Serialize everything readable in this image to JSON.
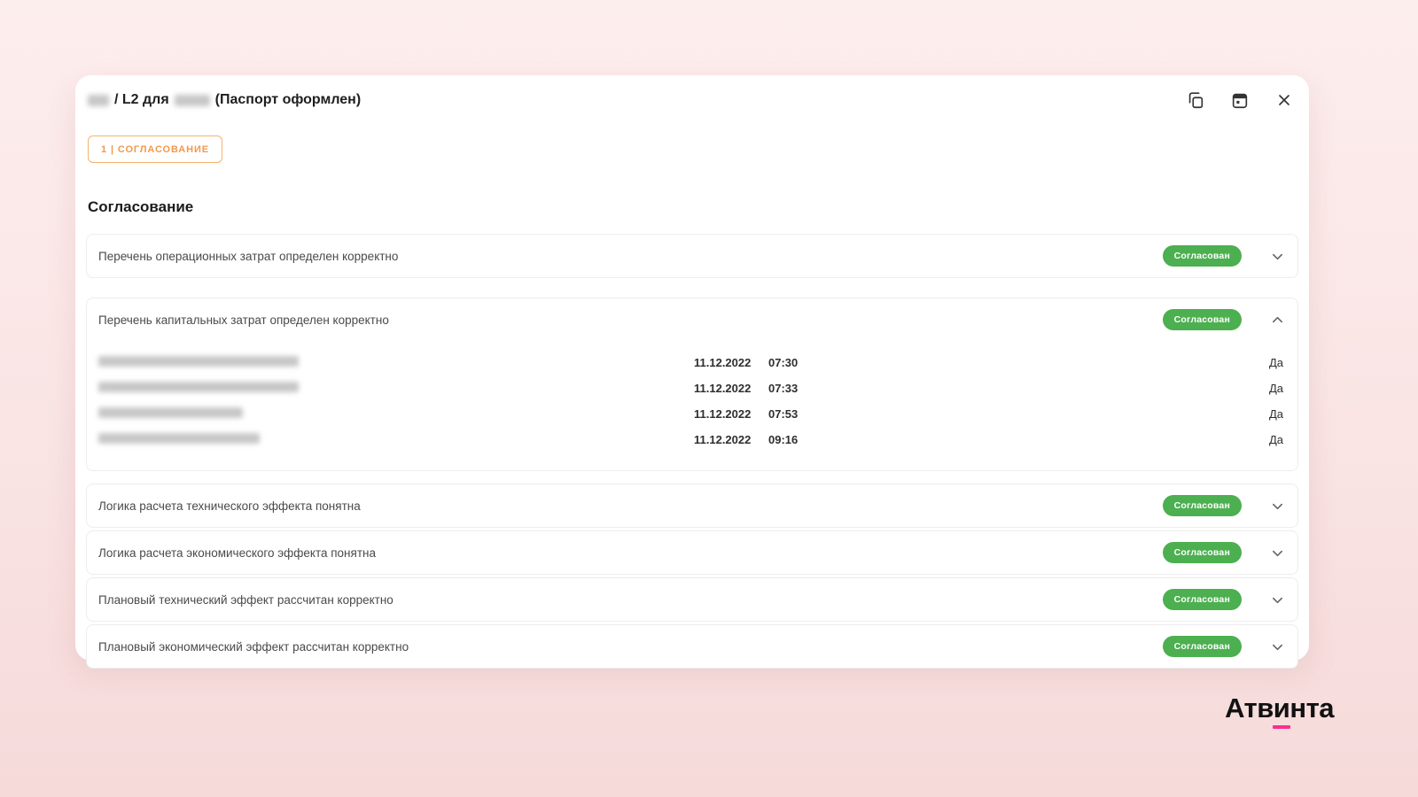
{
  "colors": {
    "status_green": "#4CAF50",
    "accent_orange": "#F2994A",
    "logo_pink": "#FF2E8D"
  },
  "header": {
    "title_part1": "/ L2 для",
    "title_part2": "(Паспорт оформлен)",
    "icons": [
      "copy-icon",
      "calendar-icon",
      "close-icon"
    ]
  },
  "stage_badge": {
    "label": "1 | СОГЛАСОВАНИЕ"
  },
  "section": {
    "title": "Согласование"
  },
  "approval": {
    "items": [
      {
        "label": "Перечень операционных затрат определен корректно",
        "status": "Согласован",
        "expanded": false
      },
      {
        "label": "Перечень капитальных затрат определен корректно",
        "status": "Согласован",
        "expanded": true,
        "approvers": [
          {
            "name": "",
            "date": "11.12.2022",
            "time": "07:30",
            "answer": "Да"
          },
          {
            "name": "",
            "date": "11.12.2022",
            "time": "07:33",
            "answer": "Да"
          },
          {
            "name": "",
            "date": "11.12.2022",
            "time": "07:53",
            "answer": "Да"
          },
          {
            "name": "",
            "date": "11.12.2022",
            "time": "09:16",
            "answer": "Да"
          }
        ]
      },
      {
        "label": "Логика расчета технического эффекта понятна",
        "status": "Согласован",
        "expanded": false
      },
      {
        "label": "Логика расчета экономического эффекта понятна",
        "status": "Согласован",
        "expanded": false
      },
      {
        "label": "Плановый технический эффект рассчитан корректно",
        "status": "Согласован",
        "expanded": false
      },
      {
        "label": "Плановый экономический эффект рассчитан корректно",
        "status": "Согласован",
        "expanded": false
      }
    ]
  },
  "footer": {
    "logo_part1": "Атв",
    "logo_underlined": "и",
    "logo_part2": "нта"
  }
}
